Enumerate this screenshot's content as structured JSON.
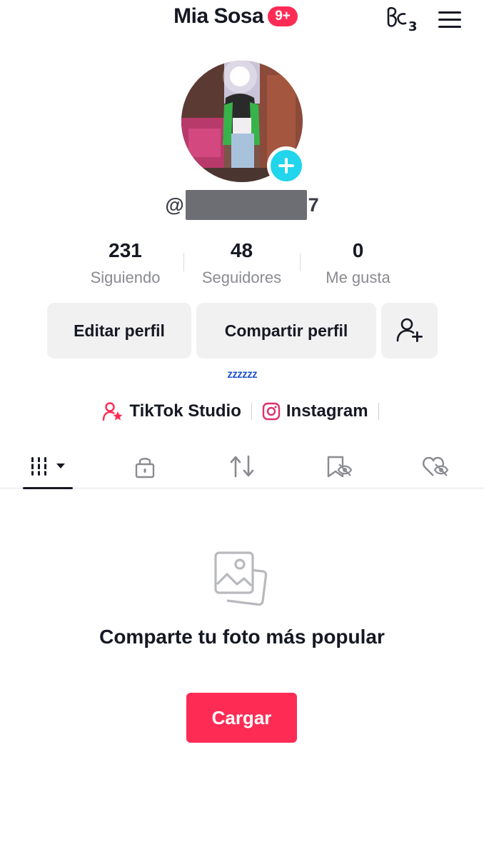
{
  "header": {
    "name": "Mia Sosa",
    "badge": "9+"
  },
  "profile": {
    "username_prefix": "@",
    "username_suffix": "7"
  },
  "stats": [
    {
      "value": "231",
      "label": "Siguiendo"
    },
    {
      "value": "48",
      "label": "Seguidores"
    },
    {
      "value": "0",
      "label": "Me gusta"
    }
  ],
  "buttons": {
    "edit": "Editar perfil",
    "share": "Compartir perfil"
  },
  "bio": "ᶻᶻᶻᶻᶻᶻ",
  "links": {
    "studio": "TikTok Studio",
    "instagram": "Instagram"
  },
  "empty": {
    "title": "Comparte tu foto más popular",
    "upload": "Cargar"
  },
  "colors": {
    "accent": "#fe2c55",
    "avatar_add": "#20d5ec",
    "bio": "#2255cc"
  }
}
